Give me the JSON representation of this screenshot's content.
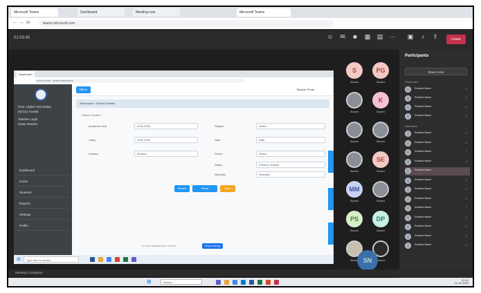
{
  "outer_browser": {
    "tabs": [
      "Microsoft Teams",
      "Dashboard",
      "Meeting now",
      "Microsoft Teams"
    ],
    "url": "teams.microsoft.com"
  },
  "meeting": {
    "timer": "01:03:45",
    "controls": [
      "People",
      "Chat",
      "React",
      "Rooms",
      "View",
      "More",
      "Camera",
      "Mic",
      "Share"
    ],
    "leave_label": "Leave"
  },
  "shared_screen": {
    "tab_label": "Dashboard",
    "url": "school portal - student attendance",
    "sidebar": {
      "org_line1": "Govt. Higher Secondary",
      "org_line2": "School, Kerala",
      "user_line1": "Teacher Login",
      "user_line2": "Class Teacher",
      "menu": [
        "Dashboard",
        "Home",
        "Students",
        "Reports",
        "Settings",
        "Profile"
      ]
    },
    "header_button": "Menu",
    "user_info": "Teacher Portal",
    "breadcrumb": "Attendance › Student Details",
    "form_title": "Search Student",
    "fields": [
      {
        "label": "Academic Year",
        "value": "2022-2023"
      },
      {
        "label": "Class",
        "value": "2022-2023"
      },
      {
        "label": "Division",
        "value": "Division"
      },
      {
        "label": "Subject",
        "value": "Select"
      },
      {
        "label": "Date",
        "value": "Date"
      },
      {
        "label": "Period",
        "value": "Period"
      },
      {
        "label": "Status",
        "value": "Present / Absent"
      },
      {
        "label": "Remarks",
        "value": "Remarks"
      }
    ],
    "buttons": {
      "search": "Search",
      "reset": "Reset",
      "save": "Save"
    },
    "share_notice": "You are sharing your screen",
    "stop_label": "Stop sharing",
    "taskbar_search": "Type here to search"
  },
  "participants_grid": [
    {
      "initials": "S",
      "color": "#f3c9c4",
      "text_color": "#b0473c",
      "name": "Student"
    },
    {
      "initials": "PG",
      "color": "#f3c9c4",
      "text_color": "#b0473c",
      "name": "Student"
    },
    {
      "initials": "",
      "color": "#8a8f96",
      "text_color": "#ffffff",
      "name": "Student"
    },
    {
      "initials": "K",
      "color": "#f5c2d3",
      "text_color": "#a23a66",
      "name": "Student"
    },
    {
      "initials": "",
      "color": "#8a8f96",
      "text_color": "#ffffff",
      "name": "Student"
    },
    {
      "initials": "",
      "color": "#8a8f96",
      "text_color": "#ffffff",
      "name": "Student"
    },
    {
      "initials": "",
      "color": "#8a8f96",
      "text_color": "#ffffff",
      "name": "Student"
    },
    {
      "initials": "SE",
      "color": "#f3c9c4",
      "text_color": "#b0473c",
      "name": "Student"
    },
    {
      "initials": "MM",
      "color": "#c9d2f3",
      "text_color": "#3c4fa8",
      "name": "Student"
    },
    {
      "initials": "",
      "color": "#8a8f96",
      "text_color": "#ffffff",
      "name": "Student"
    },
    {
      "initials": "PS",
      "color": "#d6efc9",
      "text_color": "#4a7b2f",
      "name": "Student"
    },
    {
      "initials": "DP",
      "color": "#c6efe6",
      "text_color": "#2f7b6a",
      "name": "Student"
    },
    {
      "initials": "",
      "color": "#c9bfae",
      "text_color": "#ffffff",
      "name": "Student"
    },
    {
      "initials": "",
      "color": "#2a2a2a",
      "text_color": "#ffffff",
      "name": "Student"
    }
  ],
  "participants_panel": {
    "title": "Participants",
    "invite": "Share invite",
    "section_presenters": "Presenters",
    "section_attendees": "Attendees",
    "people": [
      "Student Name",
      "Student Name",
      "Student Name",
      "Student Name",
      "Student Name",
      "Student Name",
      "Student Name",
      "Student Name",
      "Student Name",
      "Student Name",
      "Student Name",
      "Student Name",
      "Student Name",
      "Student Name",
      "Student Name",
      "Student Name",
      "Student Name"
    ]
  },
  "self_view": {
    "initials": "SN"
  },
  "status_strip": "Meeting in progress",
  "windows": {
    "search": "Search",
    "time": "12:12",
    "date": "21-02-2023"
  }
}
